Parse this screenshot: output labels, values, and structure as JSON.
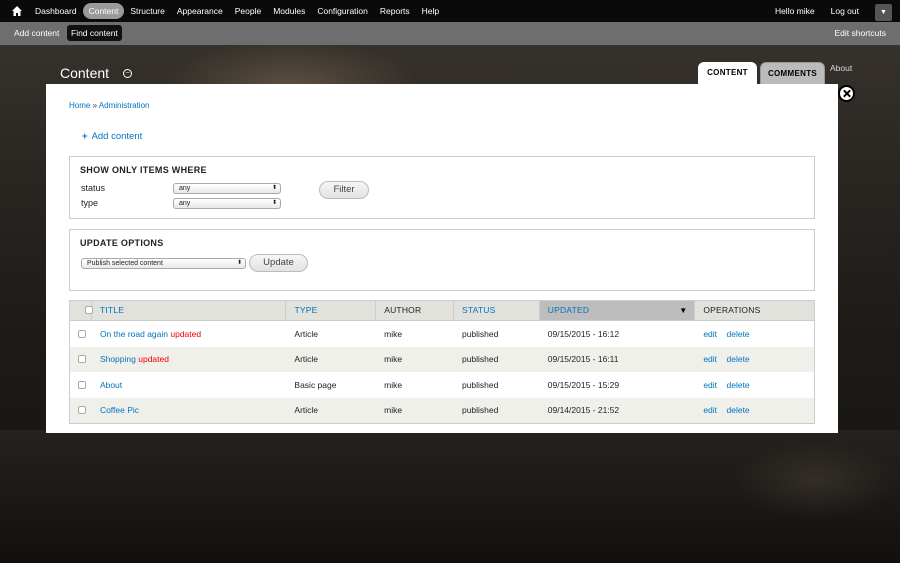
{
  "toolbar": {
    "menu": [
      "Dashboard",
      "Content",
      "Structure",
      "Appearance",
      "People",
      "Modules",
      "Configuration",
      "Reports",
      "Help"
    ],
    "active_index": 1,
    "user": "Hello mike",
    "logout": "Log out"
  },
  "shortcuts": {
    "add": "Add content",
    "find": "Find content",
    "edit": "Edit shortcuts"
  },
  "page": {
    "title": "Content",
    "tabs": [
      "CONTENT",
      "COMMENTS"
    ],
    "about": "About"
  },
  "breadcrumb": {
    "home": "Home",
    "sep": " » ",
    "admin": "Administration"
  },
  "add_content": "Add content",
  "filter": {
    "legend": "SHOW ONLY ITEMS WHERE",
    "status_label": "status",
    "status_value": "any",
    "type_label": "type",
    "type_value": "any",
    "button": "Filter"
  },
  "update": {
    "legend": "UPDATE OPTIONS",
    "action": "Publish selected content",
    "button": "Update"
  },
  "table": {
    "headers": [
      "TITLE",
      "TYPE",
      "AUTHOR",
      "STATUS",
      "UPDATED",
      "OPERATIONS"
    ],
    "rows": [
      {
        "title": "On the road again",
        "flag": "updated",
        "type": "Article",
        "author": "mike",
        "status": "published",
        "updated": "09/15/2015 - 16:12",
        "edit": "edit",
        "delete": "delete"
      },
      {
        "title": "Shopping",
        "flag": "updated",
        "type": "Article",
        "author": "mike",
        "status": "published",
        "updated": "09/15/2015 - 16:11",
        "edit": "edit",
        "delete": "delete"
      },
      {
        "title": "About",
        "flag": "",
        "type": "Basic page",
        "author": "mike",
        "status": "published",
        "updated": "09/15/2015 - 15:29",
        "edit": "edit",
        "delete": "delete"
      },
      {
        "title": "Coffee Pic",
        "flag": "",
        "type": "Article",
        "author": "mike",
        "status": "published",
        "updated": "09/14/2015 - 21:52",
        "edit": "edit",
        "delete": "delete"
      }
    ]
  },
  "colors": {
    "link": "#0074bd",
    "updated_flag": "#e00000",
    "toolbar": "#0a0a0a"
  }
}
